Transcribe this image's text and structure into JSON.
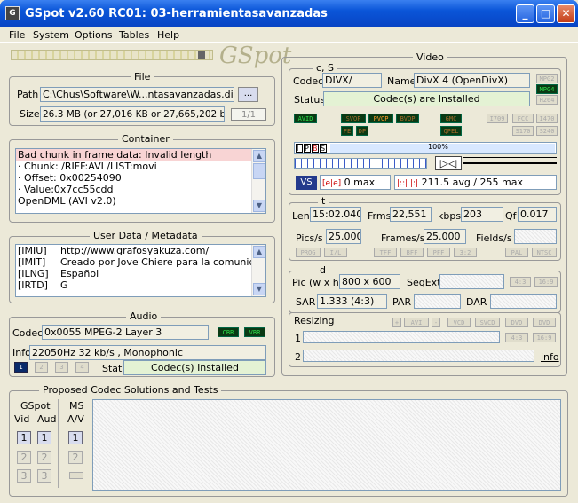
{
  "window": {
    "title": "GSpot v2.60 RC01: 03-herramientasavanzadas",
    "app_icon": "G"
  },
  "menu": [
    "File",
    "System",
    "Options",
    "Tables",
    "Help"
  ],
  "logo": "GSpot",
  "file": {
    "label": "File",
    "path_label": "Path",
    "path_value": "C:\\Chus\\Software\\W...ntasavanzadas.divx",
    "browse": "...",
    "size_label": "Size",
    "size_value": "26.3 MB (or 27,016 KB or 27,665,202 bytes",
    "page": "1/1"
  },
  "container": {
    "label": "Container",
    "lines": [
      "Bad chunk in frame data: Invalid length",
      " · Chunk: /RIFF:AVI /LIST:movi",
      " · Offset: 0x00254090",
      " · Value:0x7cc55cdd",
      "OpenDML (AVI v2.0)"
    ]
  },
  "metadata": {
    "label": "User Data / Metadata",
    "rows": [
      {
        "k": "[IMIU]",
        "v": "http://www.grafosyakuza.com/"
      },
      {
        "k": "[IMIT]",
        "v": "Creado por Jove Chiere para la comunidad Sti"
      },
      {
        "k": "[ILNG]",
        "v": "Español"
      },
      {
        "k": "[IRTD]",
        "v": "G"
      }
    ]
  },
  "audio": {
    "label": "Audio",
    "codec_label": "Codec",
    "codec_value": "0x0055  MPEG-2 Layer 3",
    "cbr": "CBR",
    "vbr": "VBR",
    "info_label": "Info",
    "info_value": "22050Hz  32 kb/s , Monophonic",
    "tracks": [
      "1",
      "2",
      "3",
      "4"
    ],
    "stat_label": "Stat",
    "stat_value": "Codec(s) Installed"
  },
  "proposed": {
    "label": "Proposed Codec Solutions and Tests",
    "gspot": "GSpot",
    "vid": "Vid",
    "aud": "Aud",
    "ms": "MS",
    "av": "A/V",
    "nums": [
      "1",
      "2",
      "3"
    ]
  },
  "video": {
    "label": "Video",
    "cs_label": "c, S",
    "codec_label": "Codec",
    "codec_value": "DIVX/",
    "name_label": "Name",
    "name_value": "DivX 4 (OpenDivX)",
    "status_label": "Status",
    "status_value": "Codec(s) are Installed",
    "mpeg_tags": [
      "MPG2",
      "MPG4",
      "H264"
    ],
    "avid": "AVID",
    "vop_tags": [
      "SVOP",
      "PVOP",
      "BVOP"
    ],
    "vop_tags2": [
      "FE",
      "DP"
    ],
    "qpel_tags": [
      "GMC",
      "QPEL"
    ],
    "right_tags": [
      "I709",
      "FCC",
      "I470",
      "S170",
      "S240"
    ],
    "ipbs": [
      "I",
      "P",
      "B",
      "S"
    ],
    "percent": "100%",
    "zero_max": "0 max",
    "avg_max": "211.5 avg / 255 max",
    "t_label": "t",
    "len_label": "Len",
    "len_value": "15:02.040",
    "frms_label": "Frms",
    "frms_value": "22,551",
    "kbps_label": "kbps",
    "kbps_value": "203",
    "qf_label": "Qf",
    "qf_value": "0.017",
    "pics_label": "Pics/s",
    "pics_value": "25.000",
    "frames_label": "Frames/s",
    "frames_value": "25.000",
    "fields_label": "Fields/s",
    "scan_tags": [
      "PROG",
      "I/L",
      "TFF",
      "BFF",
      "PFF",
      "3:2",
      "PAL",
      "NTSC"
    ],
    "d_label": "d",
    "pic_label": "Pic (w x h)",
    "pic_value": "800 x 600",
    "seqext_label": "SeqExt",
    "ar_tags": [
      "4:3",
      "16:9"
    ],
    "sar_label": "SAR",
    "sar_value": "1.333 (4:3)",
    "par_label": "PAR",
    "dar_label": "DAR",
    "resizing_label": "Resizing",
    "resize_tags": [
      "+",
      "AVI",
      "-",
      "VCD",
      "SVCD",
      "DVD",
      "DVD"
    ],
    "resize_tags2": [
      "4:3",
      "16:9"
    ],
    "r1": "1",
    "r2": "2",
    "info_link": "info"
  }
}
